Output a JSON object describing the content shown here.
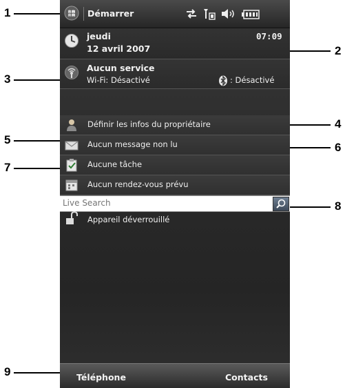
{
  "callouts": [
    "1",
    "2",
    "3",
    "4",
    "5",
    "6",
    "7",
    "8",
    "9"
  ],
  "titlebar": {
    "title": "Démarrer"
  },
  "date": {
    "day": "jeudi",
    "full_date": "12 avril 2007",
    "time": "07:09"
  },
  "connection": {
    "service": "Aucun service",
    "wifi": "Wi-Fi: Désactivé",
    "bluetooth": ": Désactivé"
  },
  "items": [
    {
      "label": "Définir les infos du propriétaire"
    },
    {
      "label": "Aucun message non lu"
    },
    {
      "label": "Aucune tâche"
    },
    {
      "label": "Aucun rendez-vous prévu"
    }
  ],
  "search": {
    "placeholder": "Live Search"
  },
  "lock": {
    "label": "Appareil déverrouillé"
  },
  "softkeys": {
    "left": "Téléphone",
    "right": "Contacts"
  },
  "colors": {
    "background": "#2a2a2a",
    "text": "#f2f2f2",
    "search_bg": "#ffffff"
  }
}
